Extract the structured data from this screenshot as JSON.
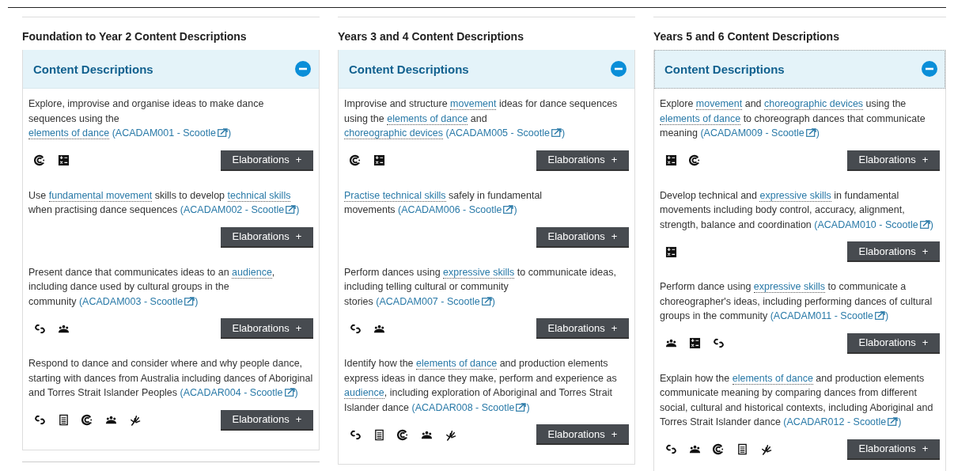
{
  "columns": [
    {
      "heading": "Foundation to Year 2 Content Descriptions",
      "panel": {
        "title": "Content Descriptions",
        "expanded": true,
        "focused": false,
        "items": [
          {
            "parts": [
              {
                "kind": "text",
                "text": "Explore, improvise and organise ideas to make dance sequences using the "
              },
              {
                "kind": "term",
                "text": "elements of dance"
              }
            ],
            "code": "(ACADAM001 - Scootle",
            "code_end": ")",
            "icons": [
              {
                "kind": "spiral"
              },
              {
                "kind": "calculator"
              }
            ],
            "button": "Elaborations",
            "button_sign": "+"
          },
          {
            "parts": [
              {
                "kind": "text",
                "text": "Use "
              },
              {
                "kind": "term",
                "text": "fundamental movement"
              },
              {
                "kind": "text",
                "text": " skills to develop "
              },
              {
                "kind": "term",
                "text": "technical skills"
              },
              {
                "kind": "text",
                "text": " when practising dance sequences"
              }
            ],
            "code": "(ACADAM002 - Scootle",
            "code_end": ")",
            "button": "Elaborations",
            "button_sign": "+"
          },
          {
            "parts": [
              {
                "kind": "text",
                "text": "Present dance that communicates ideas to an "
              },
              {
                "kind": "term",
                "text": "audience"
              },
              {
                "kind": "text",
                "text": ", including dance used by cultural groups in the community"
              }
            ],
            "code": "(ACADAM003 - Scootle",
            "code_end": ")",
            "icons": [
              {
                "kind": "rings"
              },
              {
                "kind": "group"
              }
            ],
            "button": "Elaborations",
            "button_sign": "+"
          },
          {
            "parts": [
              {
                "kind": "text",
                "text": "Respond to dance and consider where and why people dance, starting with dances from Australia including dances of Aboriginal and Torres Strait Islander Peoples"
              }
            ],
            "code": "(ACADAR004 - Scootle",
            "code_end": ")",
            "icons": [
              {
                "kind": "rings"
              },
              {
                "kind": "document"
              },
              {
                "kind": "spiral"
              },
              {
                "kind": "group"
              },
              {
                "kind": "hand"
              }
            ],
            "button": "Elaborations",
            "button_sign": "+"
          }
        ]
      }
    },
    {
      "heading": "Years 3 and 4 Content Descriptions",
      "panel": {
        "title": "Content Descriptions",
        "expanded": true,
        "focused": false,
        "items": [
          {
            "parts": [
              {
                "kind": "text",
                "text": "Improvise and structure "
              },
              {
                "kind": "term",
                "text": "movement"
              },
              {
                "kind": "text",
                "text": " ideas for dance sequences using the "
              },
              {
                "kind": "term",
                "text": "elements of dance"
              },
              {
                "kind": "text",
                "text": " and "
              },
              {
                "kind": "term",
                "text": "choreographic devices"
              }
            ],
            "code": "(ACADAM005 - Scootle",
            "code_end": ")",
            "icons": [
              {
                "kind": "spiral"
              },
              {
                "kind": "calculator"
              }
            ],
            "button": "Elaborations",
            "button_sign": "+"
          },
          {
            "parts": [
              {
                "kind": "term",
                "text": "Practise technical skills"
              },
              {
                "kind": "text",
                "text": " safely in fundamental movements"
              }
            ],
            "code": "(ACADAM006 - Scootle",
            "code_end": ")",
            "button": "Elaborations",
            "button_sign": "+"
          },
          {
            "parts": [
              {
                "kind": "text",
                "text": "Perform dances using "
              },
              {
                "kind": "term",
                "text": "expressive skills"
              },
              {
                "kind": "text",
                "text": " to communicate ideas, including telling cultural or community stories"
              }
            ],
            "code": "(ACADAM007 - Scootle",
            "code_end": ")",
            "icons": [
              {
                "kind": "rings"
              },
              {
                "kind": "group"
              }
            ],
            "button": "Elaborations",
            "button_sign": "+"
          },
          {
            "parts": [
              {
                "kind": "text",
                "text": "Identify how the "
              },
              {
                "kind": "term",
                "text": "elements of dance"
              },
              {
                "kind": "text",
                "text": " and production elements express ideas in dance they make, perform and experience as "
              },
              {
                "kind": "term",
                "text": "audience"
              },
              {
                "kind": "text",
                "text": ", including exploration of Aboriginal and Torres Strait Islander dance"
              }
            ],
            "code": "(ACADAR008 - Scootle",
            "code_end": ")",
            "icons": [
              {
                "kind": "rings"
              },
              {
                "kind": "document"
              },
              {
                "kind": "spiral"
              },
              {
                "kind": "group"
              },
              {
                "kind": "hand"
              }
            ],
            "button": "Elaborations",
            "button_sign": "+"
          }
        ]
      }
    },
    {
      "heading": "Years 5 and 6 Content Descriptions",
      "panel": {
        "title": "Content Descriptions",
        "expanded": true,
        "focused": true,
        "items": [
          {
            "parts": [
              {
                "kind": "text",
                "text": "Explore "
              },
              {
                "kind": "term",
                "text": "movement"
              },
              {
                "kind": "text",
                "text": " and "
              },
              {
                "kind": "term",
                "text": "choreographic devices"
              },
              {
                "kind": "text",
                "text": " using the "
              },
              {
                "kind": "term",
                "text": "elements of dance"
              },
              {
                "kind": "text",
                "text": " to choreograph dances that communicate meaning"
              }
            ],
            "code": "(ACADAM009 - Scootle",
            "code_end": ")",
            "icons": [
              {
                "kind": "calculator"
              },
              {
                "kind": "spiral"
              }
            ],
            "button": "Elaborations",
            "button_sign": "+"
          },
          {
            "parts": [
              {
                "kind": "text",
                "text": "Develop technical and "
              },
              {
                "kind": "term",
                "text": "expressive skills"
              },
              {
                "kind": "text",
                "text": " in fundamental movements including body control, accuracy, alignment, strength, balance and coordination"
              }
            ],
            "code": "(ACADAM010 - Scootle",
            "code_end": ")",
            "icons": [
              {
                "kind": "calculator"
              }
            ],
            "button": "Elaborations",
            "button_sign": "+"
          },
          {
            "parts": [
              {
                "kind": "text",
                "text": "Perform dance using "
              },
              {
                "kind": "term",
                "text": "expressive skills"
              },
              {
                "kind": "text",
                "text": " to communicate a choreographer's ideas, including performing dances of cultural groups in the community"
              }
            ],
            "code": "(ACADAM011 - Scootle",
            "code_end": ")",
            "icons": [
              {
                "kind": "group"
              },
              {
                "kind": "calculator"
              },
              {
                "kind": "rings"
              }
            ],
            "button": "Elaborations",
            "button_sign": "+"
          },
          {
            "parts": [
              {
                "kind": "text",
                "text": "Explain how the "
              },
              {
                "kind": "term",
                "text": "elements of dance"
              },
              {
                "kind": "text",
                "text": " and production elements communicate meaning by comparing dances from different social, cultural and historical contexts, including Aboriginal and Torres Strait Islander dance"
              }
            ],
            "code": "(ACADAR012 - Scootle",
            "code_end": ")",
            "icons": [
              {
                "kind": "rings"
              },
              {
                "kind": "group"
              },
              {
                "kind": "spiral"
              },
              {
                "kind": "document"
              },
              {
                "kind": "hand"
              }
            ],
            "button": "Elaborations",
            "button_sign": "+"
          }
        ]
      }
    }
  ]
}
